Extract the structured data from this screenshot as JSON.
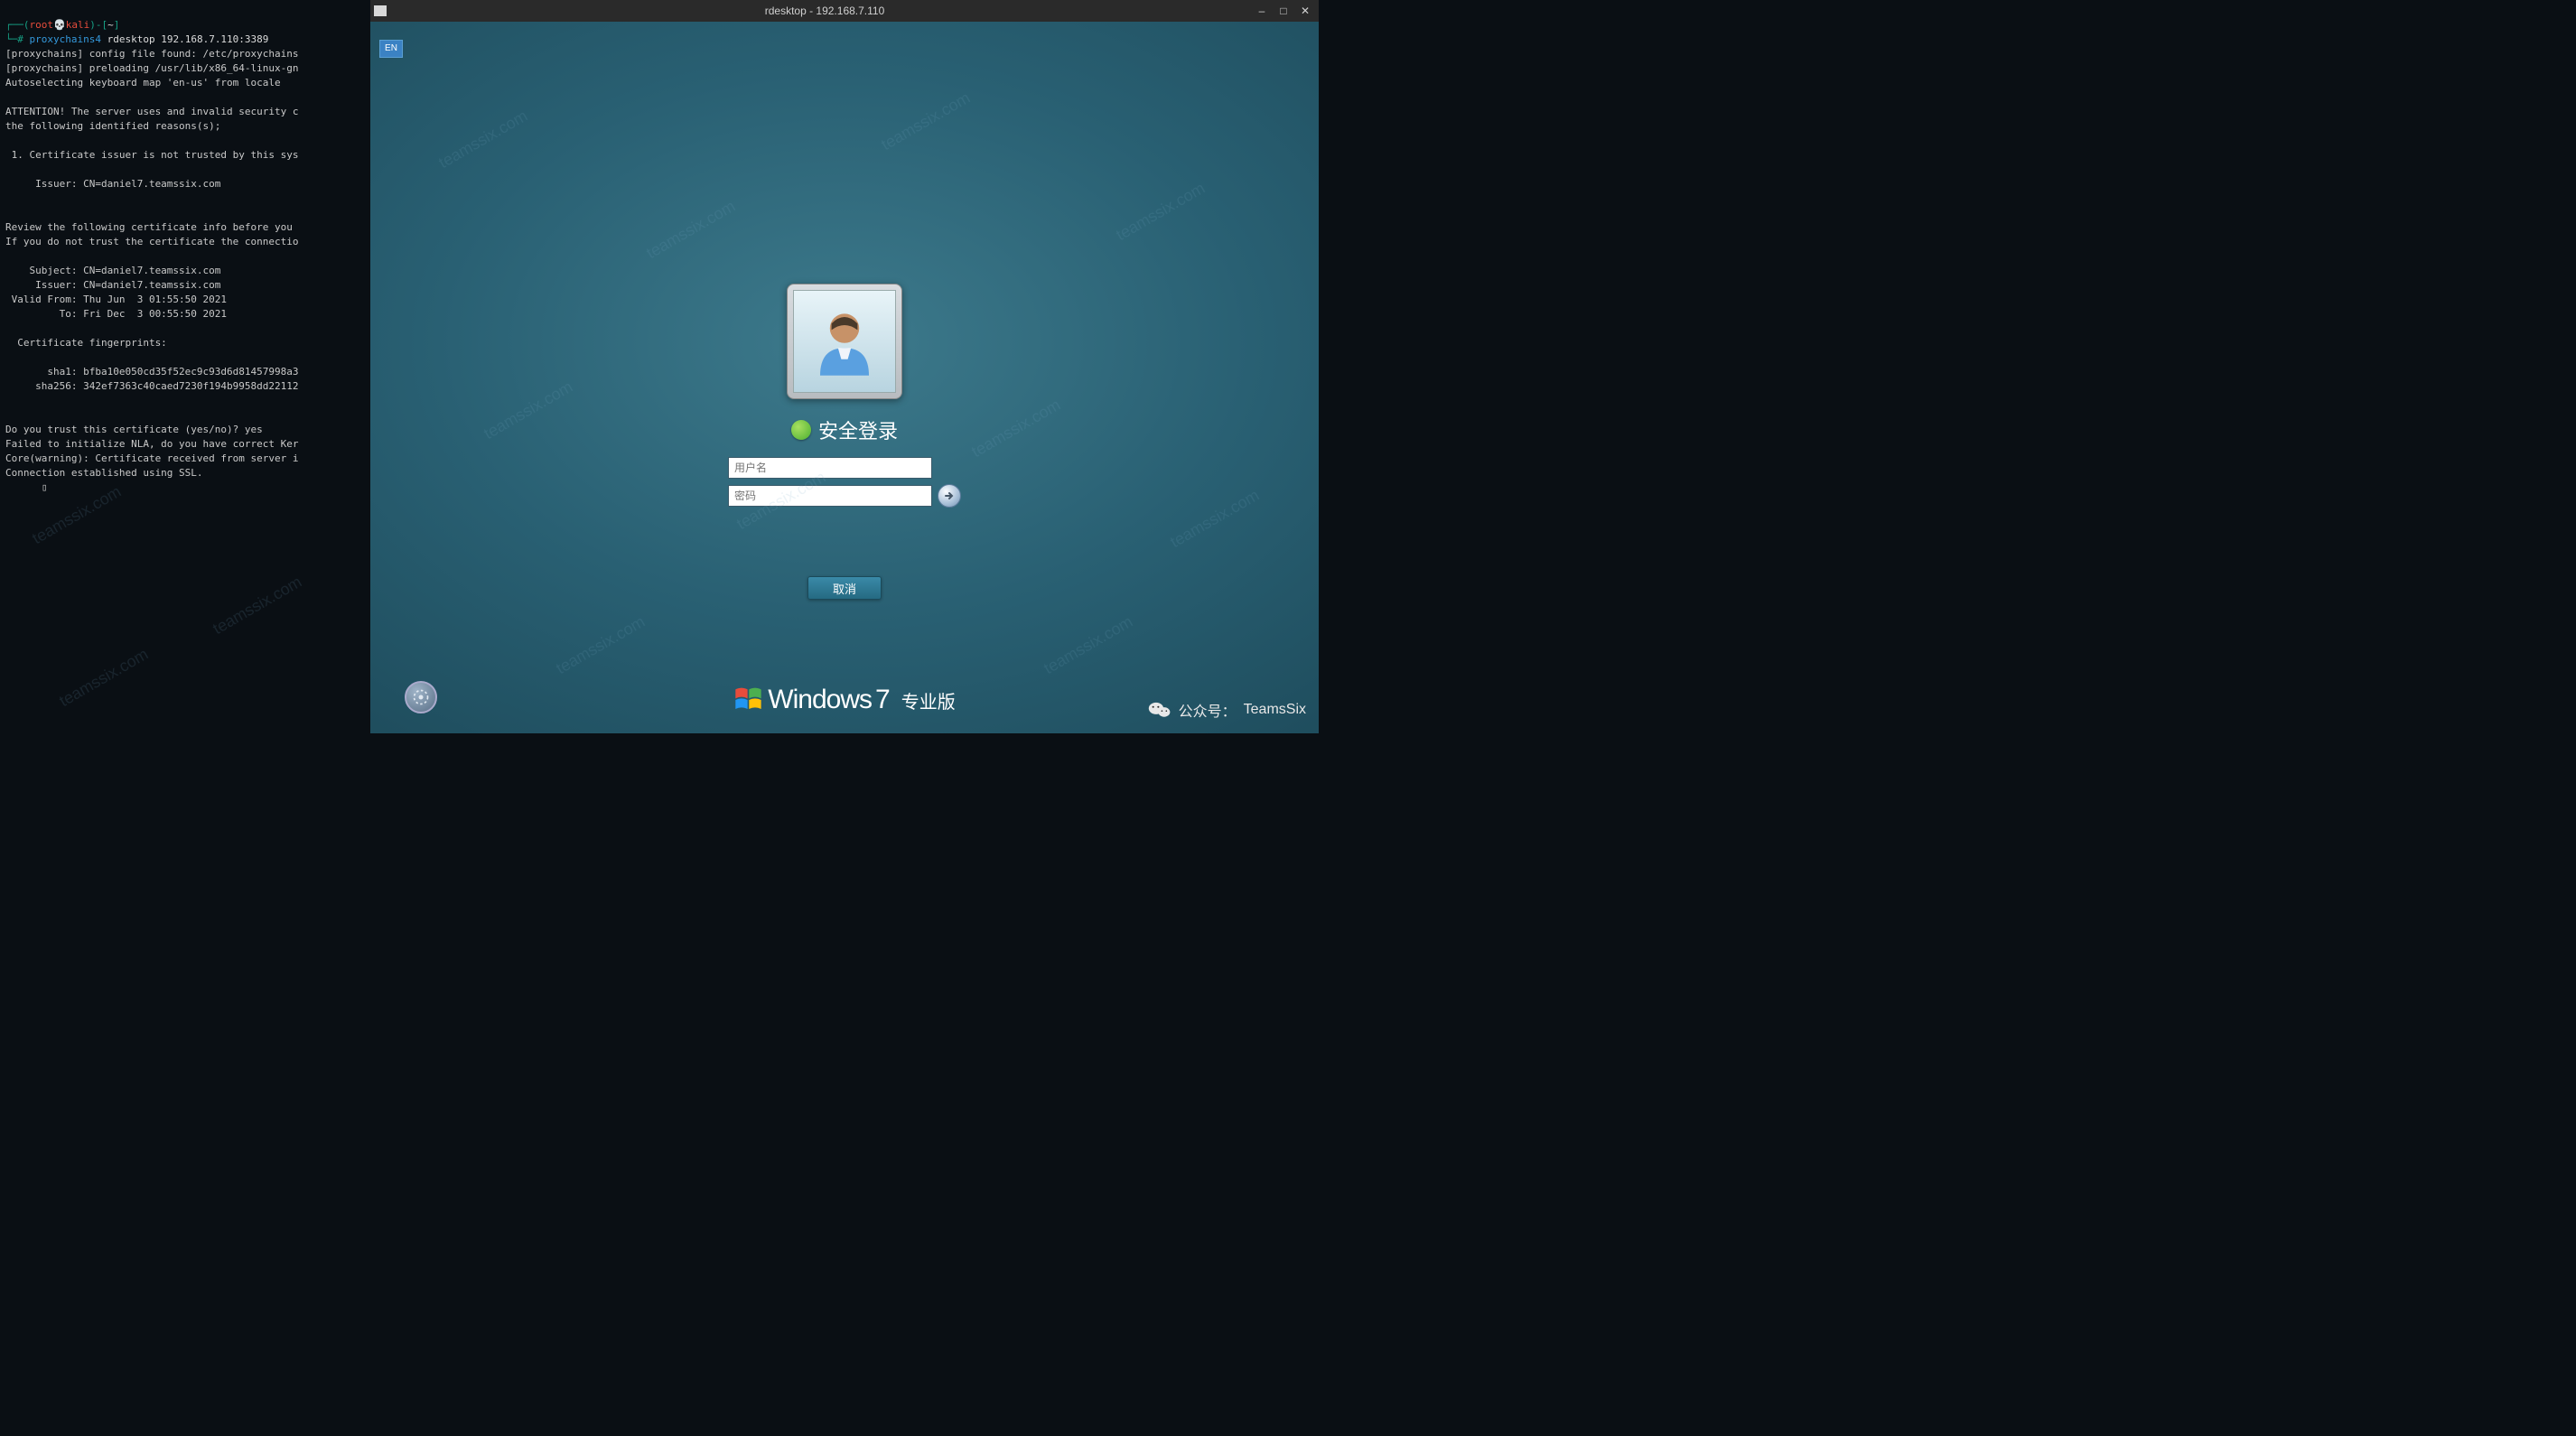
{
  "terminal": {
    "prompt": {
      "open": "┌──(",
      "user": "root",
      "skull": "💀",
      "host": "kali",
      "close": ")-[",
      "path": "~",
      "end": "]",
      "line2_prefix": "└─#",
      "cmd_proxychains": "proxychains4",
      "cmd_rest": " rdesktop 192.168.7.110:3389"
    },
    "lines": [
      "[proxychains] config file found: /etc/proxychains",
      "[proxychains] preloading /usr/lib/x86_64-linux-gn",
      "Autoselecting keyboard map 'en-us' from locale",
      "",
      "ATTENTION! The server uses and invalid security c",
      "the following identified reasons(s);",
      "",
      " 1. Certificate issuer is not trusted by this sys",
      "",
      "     Issuer: CN=daniel7.teamssix.com",
      "",
      "",
      "Review the following certificate info before you ",
      "If you do not trust the certificate the connectio",
      "",
      "    Subject: CN=daniel7.teamssix.com",
      "     Issuer: CN=daniel7.teamssix.com",
      " Valid From: Thu Jun  3 01:55:50 2021",
      "         To: Fri Dec  3 00:55:50 2021",
      "",
      "  Certificate fingerprints:",
      "",
      "       sha1: bfba10e050cd35f52ec9c93d6d81457998a3",
      "     sha256: 342ef7363c40caed7230f194b9958dd22112",
      "",
      "",
      "Do you trust this certificate (yes/no)? yes",
      "Failed to initialize NLA, do you have correct Ker",
      "Core(warning): Certificate received from server i",
      "Connection established using SSL.",
      "      ▯"
    ]
  },
  "rdesktop": {
    "titlebar": "rdesktop - 192.168.7.110",
    "lang": "EN",
    "secure_login": "安全登录",
    "username_placeholder": "用户名",
    "password_placeholder": "密码",
    "cancel": "取消",
    "brand_windows": "Windows",
    "brand_seven": "7",
    "brand_edition": "专业版"
  },
  "footer": {
    "wechat_label": "公众号：",
    "wechat_name": "TeamsSix"
  },
  "watermark": "teamssix.com"
}
